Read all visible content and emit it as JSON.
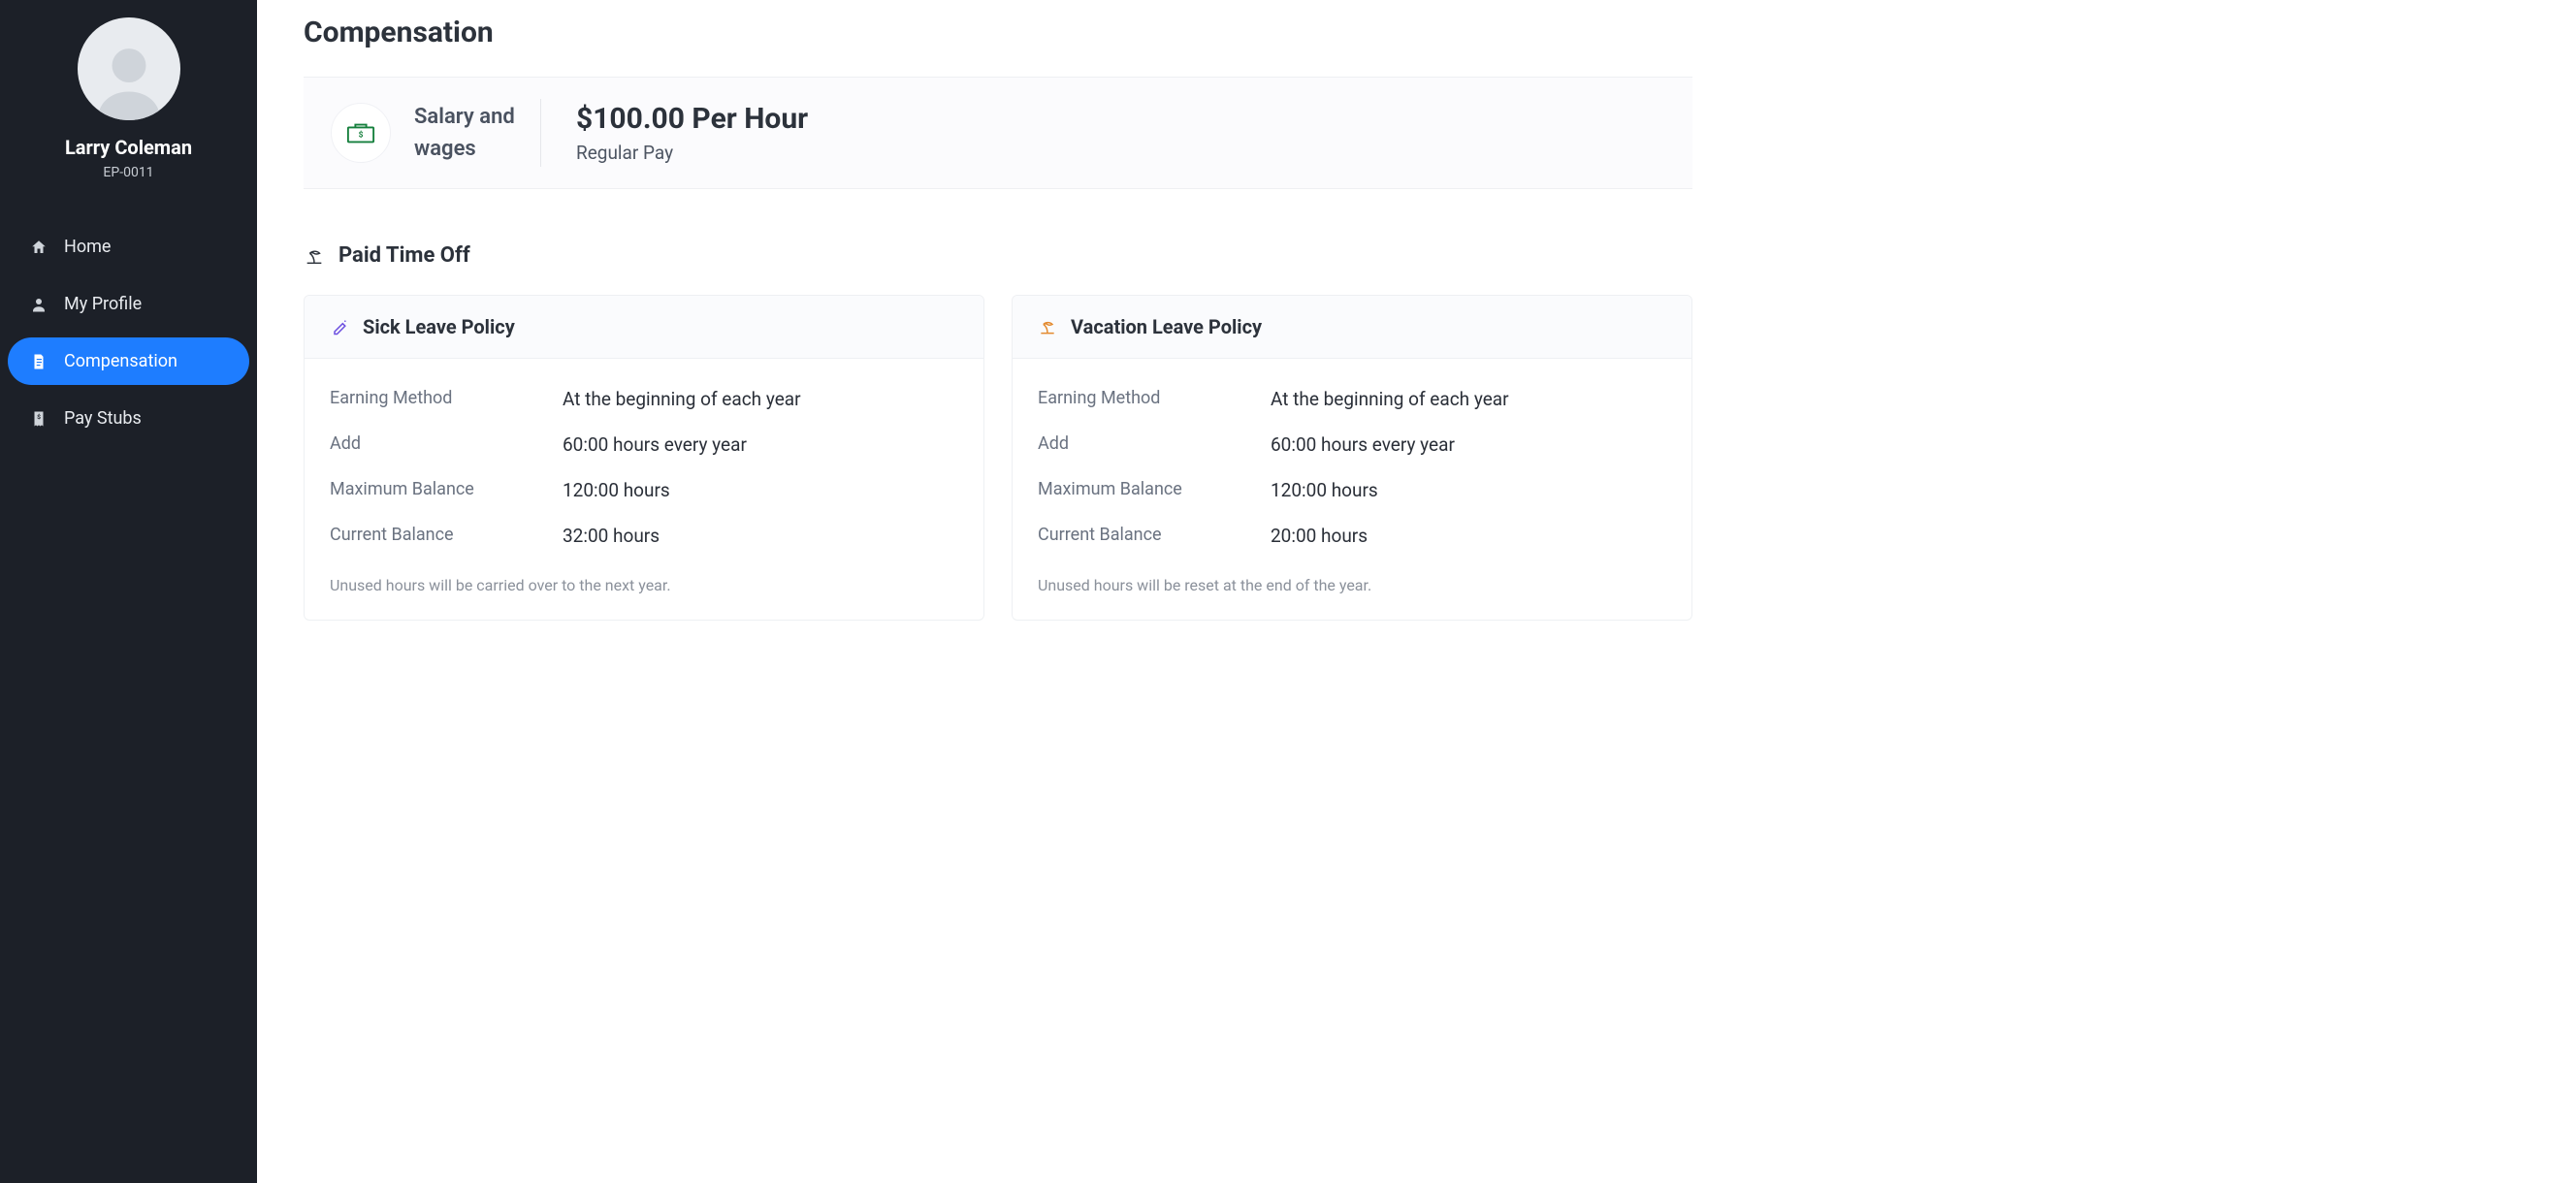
{
  "user": {
    "name": "Larry Coleman",
    "id": "EP-0011"
  },
  "nav": {
    "home": "Home",
    "profile": "My Profile",
    "compensation": "Compensation",
    "paystubs": "Pay Stubs"
  },
  "page": {
    "title": "Compensation"
  },
  "salary": {
    "label": "Salary and wages",
    "value": "$100.00 Per Hour",
    "sub": "Regular Pay"
  },
  "pto": {
    "section_title": "Paid Time Off",
    "labels": {
      "earning_method": "Earning Method",
      "add": "Add",
      "max_balance": "Maximum Balance",
      "current_balance": "Current Balance"
    },
    "sick": {
      "title": "Sick Leave Policy",
      "earning_method": "At the beginning of each year",
      "add": "60:00 hours every year",
      "max_balance": "120:00 hours",
      "current_balance": "32:00 hours",
      "note": "Unused hours will be carried over to the next year."
    },
    "vacation": {
      "title": "Vacation Leave Policy",
      "earning_method": "At the beginning of each year",
      "add": "60:00 hours every year",
      "max_balance": "120:00 hours",
      "current_balance": "20:00 hours",
      "note": "Unused hours will be reset at the end of the year."
    }
  }
}
